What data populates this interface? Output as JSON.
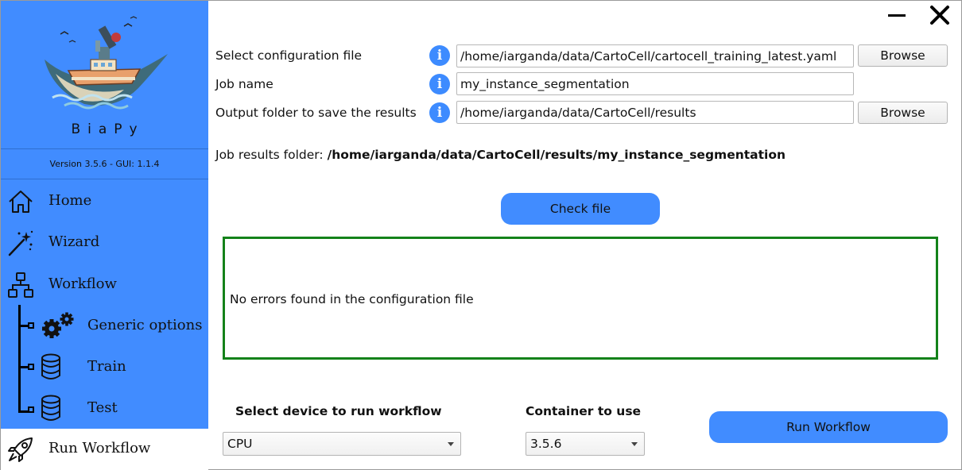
{
  "app": {
    "brand": "BiaPy",
    "version": "Version 3.5.6 - GUI: 1.1.4"
  },
  "sidebar": {
    "items": [
      {
        "label": "Home",
        "icon": "home-icon"
      },
      {
        "label": "Wizard",
        "icon": "magic-wand-icon"
      },
      {
        "label": "Workflow",
        "icon": "workflow-icon"
      },
      {
        "label": "Generic options",
        "icon": "gears-icon"
      },
      {
        "label": "Train",
        "icon": "database-icon"
      },
      {
        "label": "Test",
        "icon": "database-icon"
      },
      {
        "label": "Run Workflow",
        "icon": "rocket-icon",
        "active": true
      }
    ]
  },
  "window_controls": {
    "minimize": "minimize-icon",
    "close": "close-icon"
  },
  "form": {
    "config_label": "Select configuration file",
    "config_value": "/home/iarganda/data/CartoCell/cartocell_training_latest.yaml",
    "job_name_label": "Job name",
    "job_name_value": "my_instance_segmentation",
    "output_label": "Output folder to save the results",
    "output_value": "/home/iarganda/data/CartoCell/results",
    "browse_label": "Browse",
    "info_glyph": "i"
  },
  "results": {
    "label": "Job results folder:",
    "path": "/home/iarganda/data/CartoCell/results/my_instance_segmentation"
  },
  "check": {
    "button_label": "Check file",
    "message": "No errors found in the configuration file"
  },
  "device": {
    "title": "Select device to run workflow",
    "selected": "CPU"
  },
  "container": {
    "title": "Container to use",
    "selected": "3.5.6"
  },
  "run": {
    "button_label": "Run Workflow"
  },
  "colors": {
    "sidebar_bg": "#418cff",
    "accent": "#418cff",
    "info_icon": "#3d8bff",
    "success_border": "#14821a"
  }
}
